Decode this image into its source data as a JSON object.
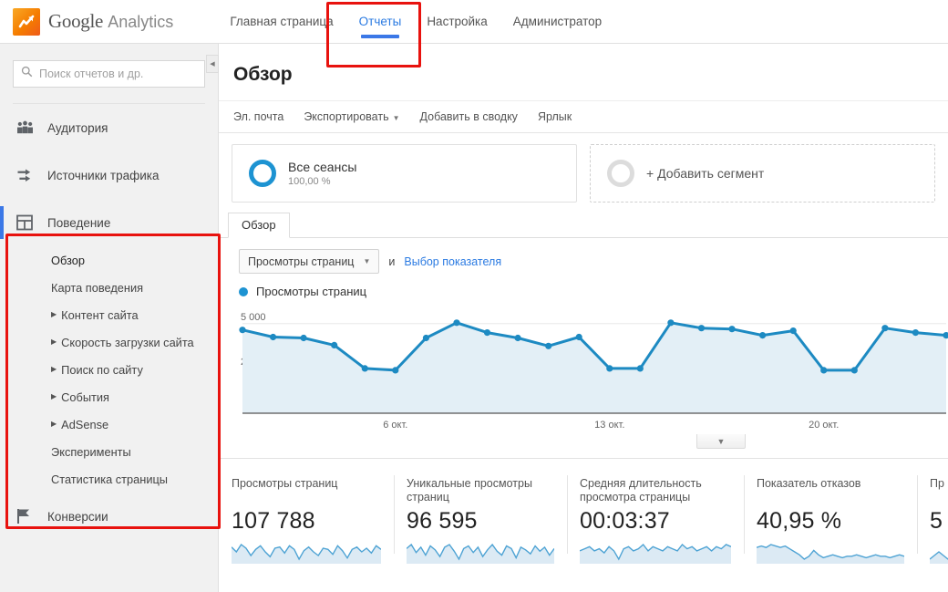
{
  "brand": {
    "name_main": "Google",
    "name_sub": "Analytics",
    "logo_icon": "analytics-logo-icon",
    "accent": "#f57c00"
  },
  "topnav": {
    "items": [
      {
        "label": "Главная страница",
        "active": false
      },
      {
        "label": "Отчеты",
        "active": true
      },
      {
        "label": "Настройка",
        "active": false
      },
      {
        "label": "Администратор",
        "active": false
      }
    ],
    "active_color": "#2a7ae2",
    "underline_color": "#3b78e7"
  },
  "annotation": {
    "color": "#e8120e",
    "targets": [
      "reports-tab",
      "behavior-section"
    ]
  },
  "sidebar": {
    "search": {
      "placeholder": "Поиск отчетов и др.",
      "icon": "search-icon"
    },
    "collapse_icon": "collapse-left-icon",
    "groups": [
      {
        "label": "Аудитория",
        "icon": "audience-people-icon",
        "active": false,
        "items": []
      },
      {
        "label": "Источники трафика",
        "icon": "traffic-arrows-icon",
        "active": false,
        "items": []
      },
      {
        "label": "Поведение",
        "icon": "behavior-grid-icon",
        "active": true,
        "items": [
          {
            "label": "Обзор",
            "expandable": false,
            "selected": true
          },
          {
            "label": "Карта поведения",
            "expandable": false,
            "selected": false
          },
          {
            "label": "Контент сайта",
            "expandable": true,
            "selected": false
          },
          {
            "label": "Скорость загрузки сайта",
            "expandable": true,
            "selected": false
          },
          {
            "label": "Поиск по сайту",
            "expandable": true,
            "selected": false
          },
          {
            "label": "События",
            "expandable": true,
            "selected": false
          },
          {
            "label": "AdSense",
            "expandable": true,
            "selected": false
          },
          {
            "label": "Эксперименты",
            "expandable": false,
            "selected": false
          },
          {
            "label": "Статистика страницы",
            "expandable": false,
            "selected": false
          }
        ]
      },
      {
        "label": "Конверсии",
        "icon": "conversions-flag-icon",
        "active": false,
        "items": []
      }
    ]
  },
  "main": {
    "title": "Обзор",
    "actions": [
      {
        "label": "Эл. почта",
        "dropdown": false
      },
      {
        "label": "Экспортировать",
        "dropdown": true
      },
      {
        "label": "Добавить в сводку",
        "dropdown": false
      },
      {
        "label": "Ярлык",
        "dropdown": false
      }
    ],
    "segments": [
      {
        "name": "Все сеансы",
        "value": "100,00 %",
        "icon": "segment-donut-icon",
        "style": "solid"
      },
      {
        "name": "+ Добавить сегмент",
        "value": "",
        "icon": "segment-donut-empty-icon",
        "style": "dashed"
      }
    ],
    "content_tabs": [
      {
        "label": "Обзор",
        "active": true
      }
    ],
    "metric_selector": {
      "value": "Просмотры страниц",
      "icon": "chevron-down-icon"
    },
    "conjunction": "и",
    "secondary_metric_link": "Выбор показателя",
    "legend": [
      {
        "label": "Просмотры страниц",
        "color": "#1d93d2"
      }
    ],
    "expander_icon": "chevron-down-icon"
  },
  "chart_data": {
    "type": "area",
    "title": "Просмотры страниц",
    "xlabel": "",
    "ylabel": "",
    "ylim": [
      0,
      5600
    ],
    "yticks": [
      2500,
      5000
    ],
    "ytick_labels": [
      "2 500",
      "5 000"
    ],
    "xtick_labels": [
      "6 окт.",
      "13 окт.",
      "20 окт."
    ],
    "xtick_indices": [
      5,
      12,
      19
    ],
    "grid": true,
    "legend_position": "top-left",
    "line_color": "#1d8ac2",
    "fill_color": "#e3eff6",
    "series": [
      {
        "name": "Просмотры страниц",
        "values": [
          4650,
          4250,
          4200,
          3800,
          2500,
          2400,
          4200,
          5050,
          4500,
          4200,
          3750,
          4250,
          2500,
          2500,
          5050,
          4750,
          4700,
          4350,
          4600,
          2400,
          2400,
          4750,
          4500,
          4350
        ]
      }
    ]
  },
  "cards": [
    {
      "label": "Просмотры страниц",
      "value": "107 788",
      "spark": [
        16,
        12,
        18,
        15,
        9,
        14,
        17,
        12,
        8,
        15,
        16,
        11,
        17,
        14,
        6,
        13,
        16,
        12,
        9,
        15,
        14,
        10,
        17,
        13,
        7,
        14,
        16,
        12,
        15,
        11,
        17,
        14
      ]
    },
    {
      "label": "Уникальные просмотры страниц",
      "value": "96 595",
      "spark": [
        14,
        17,
        11,
        15,
        9,
        16,
        13,
        8,
        15,
        17,
        12,
        6,
        14,
        16,
        11,
        15,
        8,
        13,
        17,
        12,
        9,
        16,
        14,
        7,
        15,
        13,
        10,
        16,
        12,
        15,
        9,
        14
      ]
    },
    {
      "label": "Средняя длительность просмотра страницы",
      "value": "00:03:37",
      "spark": [
        13,
        14,
        15,
        13,
        14,
        12,
        15,
        13,
        9,
        14,
        15,
        13,
        14,
        16,
        13,
        15,
        14,
        13,
        15,
        14,
        13,
        16,
        14,
        15,
        13,
        14,
        15,
        13,
        15,
        14,
        16,
        15
      ]
    },
    {
      "label": "Показатель отказов",
      "value": "40,95 %",
      "spark": [
        15,
        16,
        15,
        17,
        16,
        15,
        16,
        14,
        12,
        10,
        7,
        9,
        13,
        10,
        8,
        9,
        10,
        9,
        8,
        9,
        9,
        10,
        9,
        8,
        9,
        10,
        9,
        9,
        8,
        9,
        10,
        9
      ]
    },
    {
      "label": "Пр",
      "value": "5",
      "spark": [
        13,
        14,
        13,
        15,
        14
      ]
    }
  ]
}
